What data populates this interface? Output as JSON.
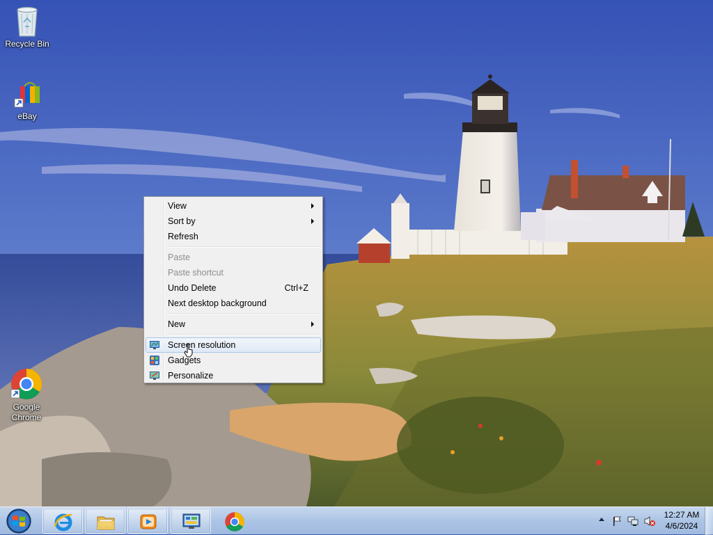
{
  "desktop": {
    "icons": [
      {
        "label": "Recycle Bin"
      },
      {
        "label": "eBay"
      },
      {
        "label": "Google Chrome"
      }
    ]
  },
  "context_menu": {
    "items": {
      "view": "View",
      "sort_by": "Sort by",
      "refresh": "Refresh",
      "paste": "Paste",
      "paste_shortcut": "Paste shortcut",
      "undo_delete": "Undo Delete",
      "undo_delete_shortcut": "Ctrl+Z",
      "next_background": "Next desktop background",
      "new": "New",
      "screen_resolution": "Screen resolution",
      "gadgets": "Gadgets",
      "personalize": "Personalize"
    },
    "hovered_item": "Screen resolution"
  },
  "taskbar": {
    "pinned": [
      "internet-explorer-icon",
      "windows-explorer-icon",
      "media-player-icon",
      "control-panel-icon",
      "chrome-icon"
    ],
    "clock": {
      "time": "12:27 AM",
      "date": "4/6/2024"
    }
  },
  "colors": {
    "sky": "#3b5fb8",
    "menu_bg": "#f0f0f0",
    "menu_hover_border": "#a8c5e8",
    "taskbar": "#aec6e6"
  }
}
